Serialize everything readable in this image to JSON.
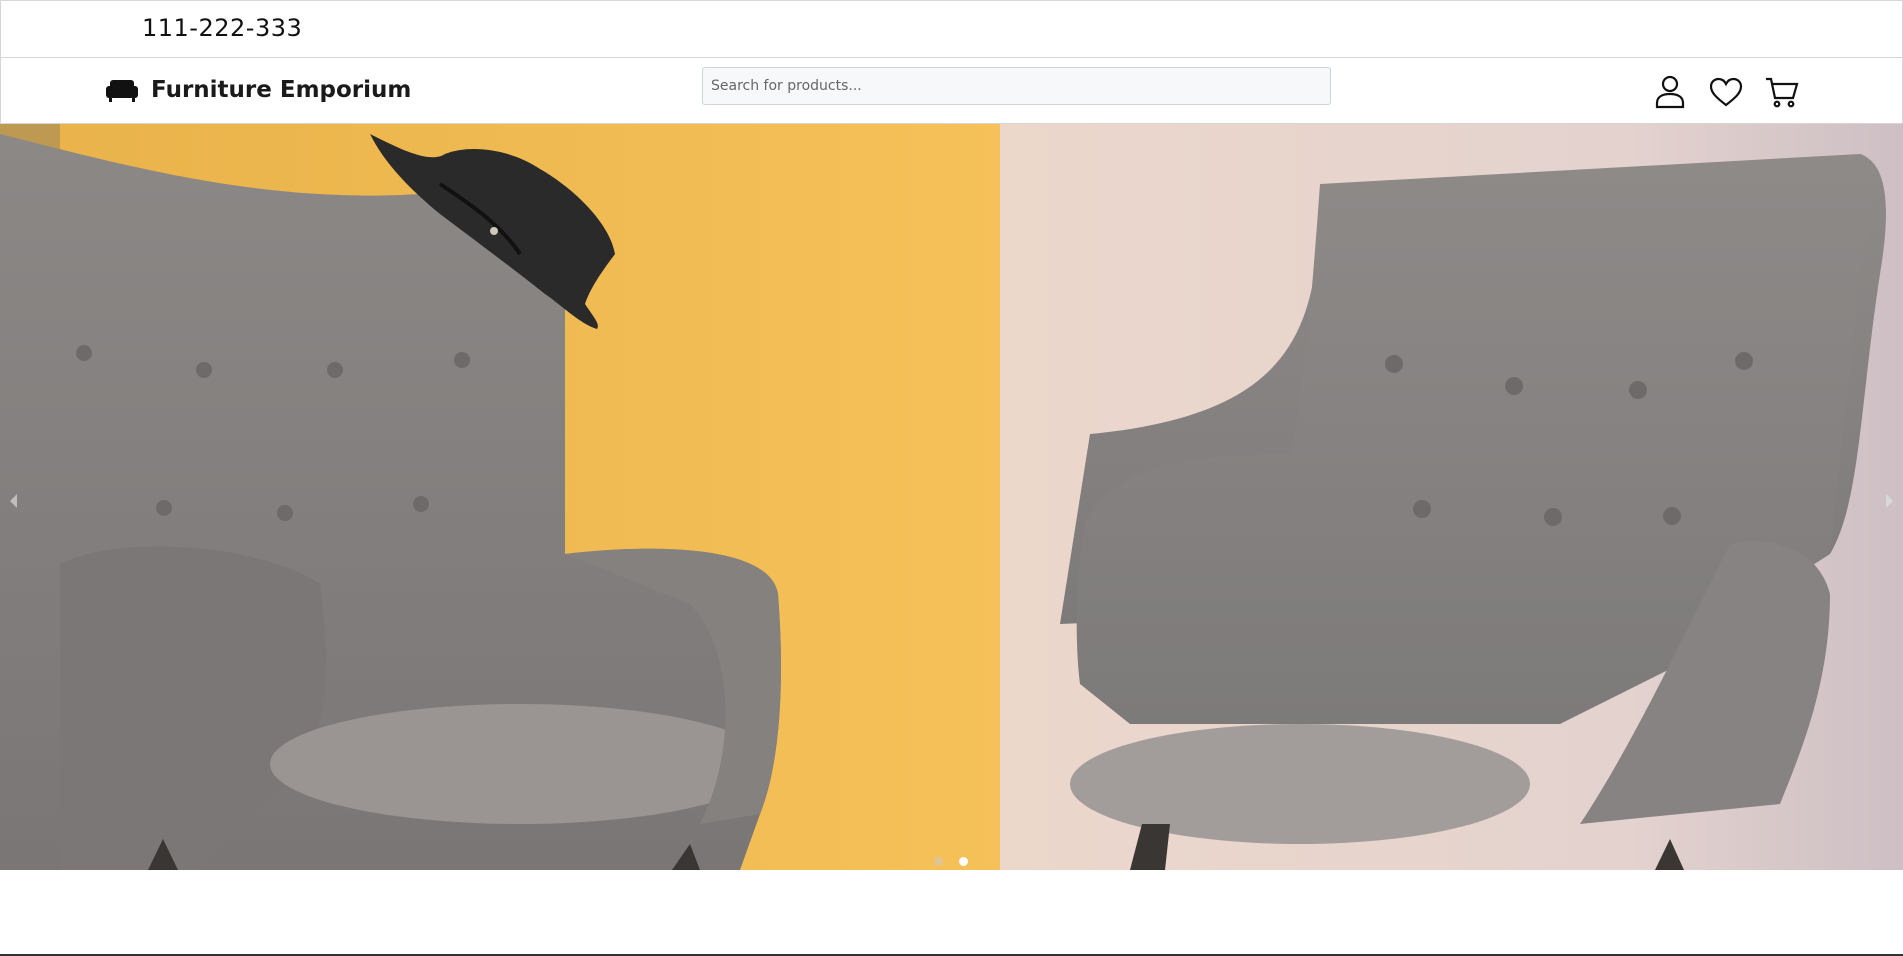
{
  "topbar": {
    "phone": "111-222-333"
  },
  "header": {
    "brand": "Furniture Emporium",
    "search_placeholder": "Search for products...",
    "icons": [
      "user-icon",
      "heart-icon",
      "cart-icon"
    ]
  },
  "hero": {
    "slide_count": 2,
    "active_slide": 2,
    "colors": {
      "wall_yellow": "#f2b94a",
      "wall_pink": "#e8d2c6",
      "chair_grey": "#8a8784"
    }
  }
}
